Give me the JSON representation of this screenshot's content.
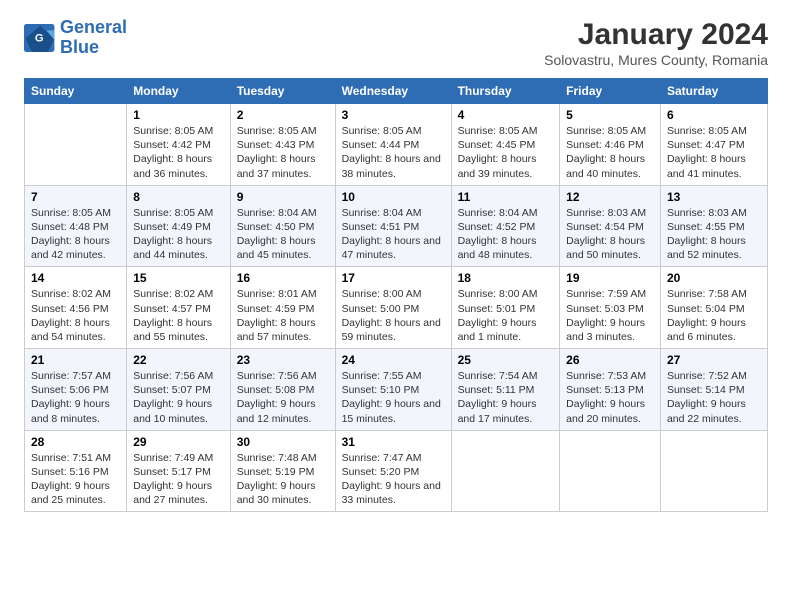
{
  "logo": {
    "line1": "General",
    "line2": "Blue"
  },
  "title": "January 2024",
  "subtitle": "Solovastru, Mures County, Romania",
  "weekdays": [
    "Sunday",
    "Monday",
    "Tuesday",
    "Wednesday",
    "Thursday",
    "Friday",
    "Saturday"
  ],
  "weeks": [
    [
      {
        "day": null
      },
      {
        "day": "1",
        "sunrise": "8:05 AM",
        "sunset": "4:42 PM",
        "daylight": "8 hours and 36 minutes."
      },
      {
        "day": "2",
        "sunrise": "8:05 AM",
        "sunset": "4:43 PM",
        "daylight": "8 hours and 37 minutes."
      },
      {
        "day": "3",
        "sunrise": "8:05 AM",
        "sunset": "4:44 PM",
        "daylight": "8 hours and 38 minutes."
      },
      {
        "day": "4",
        "sunrise": "8:05 AM",
        "sunset": "4:45 PM",
        "daylight": "8 hours and 39 minutes."
      },
      {
        "day": "5",
        "sunrise": "8:05 AM",
        "sunset": "4:46 PM",
        "daylight": "8 hours and 40 minutes."
      },
      {
        "day": "6",
        "sunrise": "8:05 AM",
        "sunset": "4:47 PM",
        "daylight": "8 hours and 41 minutes."
      }
    ],
    [
      {
        "day": "7",
        "sunrise": "8:05 AM",
        "sunset": "4:48 PM",
        "daylight": "8 hours and 42 minutes."
      },
      {
        "day": "8",
        "sunrise": "8:05 AM",
        "sunset": "4:49 PM",
        "daylight": "8 hours and 44 minutes."
      },
      {
        "day": "9",
        "sunrise": "8:04 AM",
        "sunset": "4:50 PM",
        "daylight": "8 hours and 45 minutes."
      },
      {
        "day": "10",
        "sunrise": "8:04 AM",
        "sunset": "4:51 PM",
        "daylight": "8 hours and 47 minutes."
      },
      {
        "day": "11",
        "sunrise": "8:04 AM",
        "sunset": "4:52 PM",
        "daylight": "8 hours and 48 minutes."
      },
      {
        "day": "12",
        "sunrise": "8:03 AM",
        "sunset": "4:54 PM",
        "daylight": "8 hours and 50 minutes."
      },
      {
        "day": "13",
        "sunrise": "8:03 AM",
        "sunset": "4:55 PM",
        "daylight": "8 hours and 52 minutes."
      }
    ],
    [
      {
        "day": "14",
        "sunrise": "8:02 AM",
        "sunset": "4:56 PM",
        "daylight": "8 hours and 54 minutes."
      },
      {
        "day": "15",
        "sunrise": "8:02 AM",
        "sunset": "4:57 PM",
        "daylight": "8 hours and 55 minutes."
      },
      {
        "day": "16",
        "sunrise": "8:01 AM",
        "sunset": "4:59 PM",
        "daylight": "8 hours and 57 minutes."
      },
      {
        "day": "17",
        "sunrise": "8:00 AM",
        "sunset": "5:00 PM",
        "daylight": "8 hours and 59 minutes."
      },
      {
        "day": "18",
        "sunrise": "8:00 AM",
        "sunset": "5:01 PM",
        "daylight": "9 hours and 1 minute."
      },
      {
        "day": "19",
        "sunrise": "7:59 AM",
        "sunset": "5:03 PM",
        "daylight": "9 hours and 3 minutes."
      },
      {
        "day": "20",
        "sunrise": "7:58 AM",
        "sunset": "5:04 PM",
        "daylight": "9 hours and 6 minutes."
      }
    ],
    [
      {
        "day": "21",
        "sunrise": "7:57 AM",
        "sunset": "5:06 PM",
        "daylight": "9 hours and 8 minutes."
      },
      {
        "day": "22",
        "sunrise": "7:56 AM",
        "sunset": "5:07 PM",
        "daylight": "9 hours and 10 minutes."
      },
      {
        "day": "23",
        "sunrise": "7:56 AM",
        "sunset": "5:08 PM",
        "daylight": "9 hours and 12 minutes."
      },
      {
        "day": "24",
        "sunrise": "7:55 AM",
        "sunset": "5:10 PM",
        "daylight": "9 hours and 15 minutes."
      },
      {
        "day": "25",
        "sunrise": "7:54 AM",
        "sunset": "5:11 PM",
        "daylight": "9 hours and 17 minutes."
      },
      {
        "day": "26",
        "sunrise": "7:53 AM",
        "sunset": "5:13 PM",
        "daylight": "9 hours and 20 minutes."
      },
      {
        "day": "27",
        "sunrise": "7:52 AM",
        "sunset": "5:14 PM",
        "daylight": "9 hours and 22 minutes."
      }
    ],
    [
      {
        "day": "28",
        "sunrise": "7:51 AM",
        "sunset": "5:16 PM",
        "daylight": "9 hours and 25 minutes."
      },
      {
        "day": "29",
        "sunrise": "7:49 AM",
        "sunset": "5:17 PM",
        "daylight": "9 hours and 27 minutes."
      },
      {
        "day": "30",
        "sunrise": "7:48 AM",
        "sunset": "5:19 PM",
        "daylight": "9 hours and 30 minutes."
      },
      {
        "day": "31",
        "sunrise": "7:47 AM",
        "sunset": "5:20 PM",
        "daylight": "9 hours and 33 minutes."
      },
      {
        "day": null
      },
      {
        "day": null
      },
      {
        "day": null
      }
    ]
  ]
}
